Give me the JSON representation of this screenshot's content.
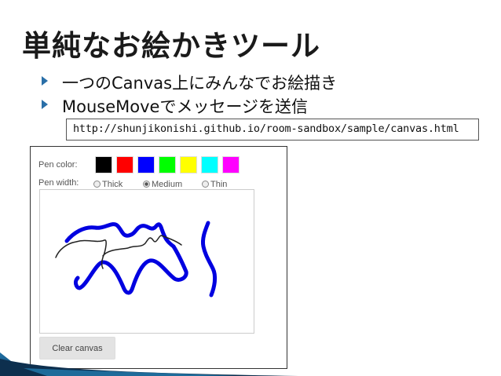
{
  "slide": {
    "title": "単純なお絵かきツール",
    "bullets": [
      {
        "text": "一つのCanvas上にみんなでお絵描き"
      },
      {
        "text": "MouseMoveでメッセージを送信"
      }
    ],
    "url": "http://shunjikonishi.github.io/room-sandbox/sample/canvas.html"
  },
  "app": {
    "pen_color_label": "Pen color:",
    "pen_width_label": "Pen width:",
    "colors": [
      "#000000",
      "#ff0000",
      "#0000ff",
      "#00ff00",
      "#ffff00",
      "#00ffff",
      "#ff00ff"
    ],
    "widths": [
      {
        "label": "Thick",
        "checked": false
      },
      {
        "label": "Medium",
        "checked": true
      },
      {
        "label": "Thin",
        "checked": false
      }
    ],
    "clear_button": "Clear canvas"
  },
  "theme": {
    "accent": "#2a6fa8",
    "stroke_blue": "#0000e0",
    "stroke_black": "#222222"
  }
}
